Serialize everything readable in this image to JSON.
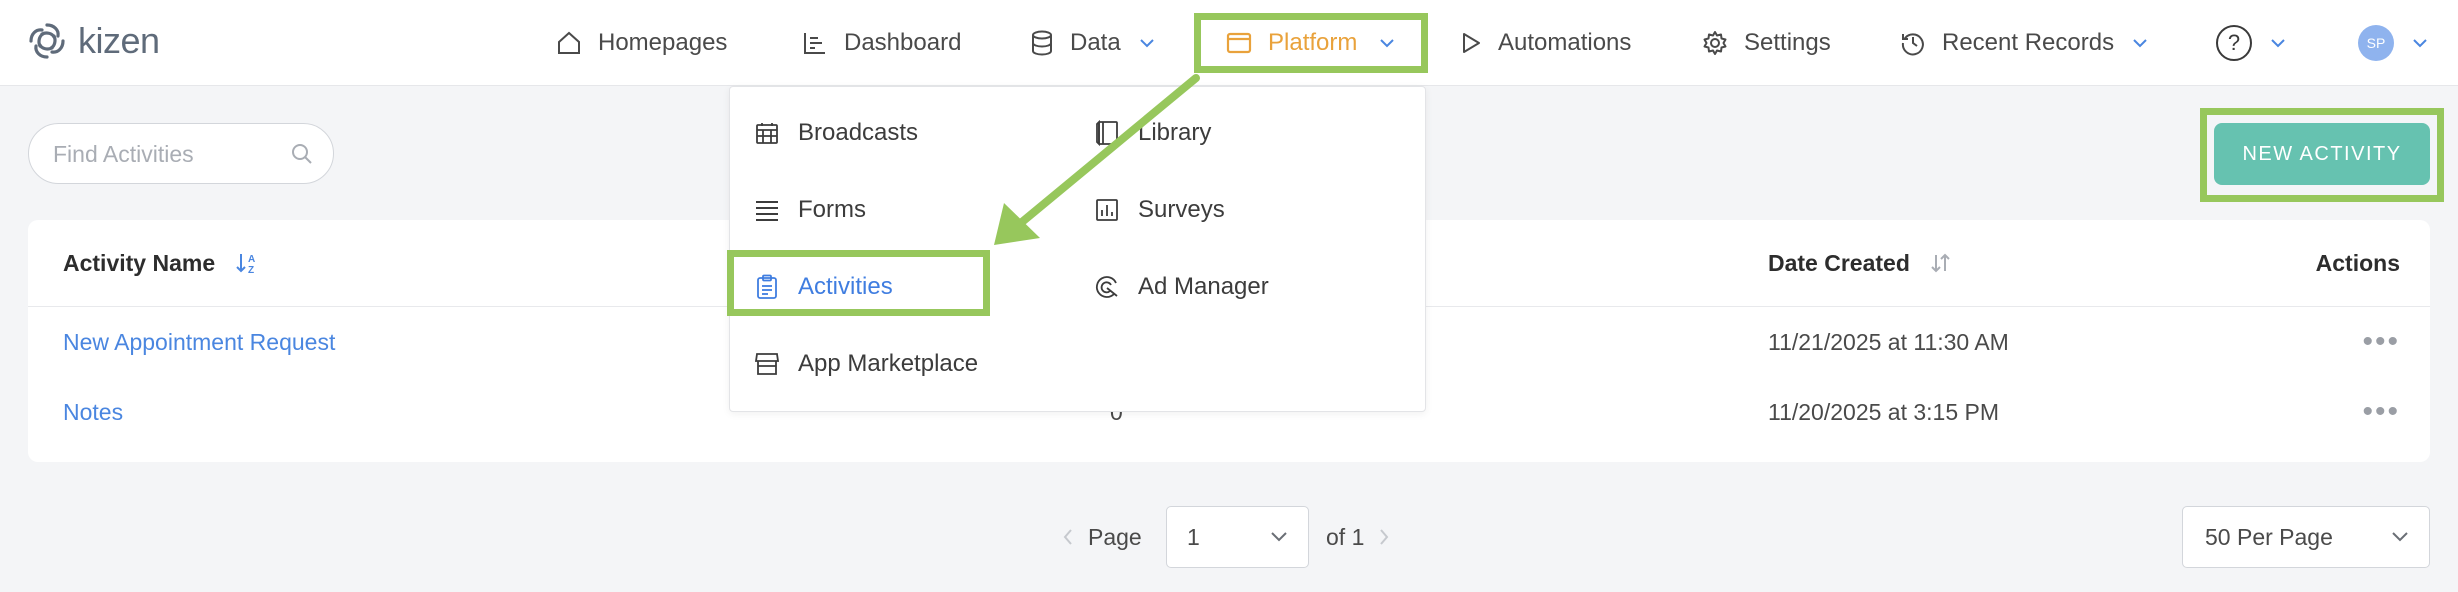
{
  "app": {
    "logo_text": "kizen"
  },
  "nav": {
    "homepages": "Homepages",
    "dashboard": "Dashboard",
    "data": "Data",
    "platform": "Platform",
    "automations": "Automations",
    "settings": "Settings",
    "recent_records": "Recent Records",
    "help_symbol": "?",
    "avatar_initials": "SP"
  },
  "platform_menu": {
    "left": [
      "Broadcasts",
      "Forms",
      "Activities",
      "App Marketplace"
    ],
    "right": [
      "Library",
      "Surveys",
      "Ad Manager"
    ],
    "active_item": "Activities"
  },
  "toolbar": {
    "search_placeholder": "Find Activities",
    "new_button": "NEW ACTIVITY"
  },
  "table": {
    "columns": {
      "name": "Activity Name",
      "date_created": "Date Created",
      "actions": "Actions"
    },
    "rows": [
      {
        "name": "New Appointment Request",
        "count": "",
        "date": "11/21/2025",
        "time": "at 11:30 AM",
        "actions": "•••"
      },
      {
        "name": "Notes",
        "count": "0",
        "date": "11/20/2025",
        "time": "at 3:15 PM",
        "actions": "•••"
      }
    ]
  },
  "pagination": {
    "page_label": "Page",
    "current_page": "1",
    "of_label": "of 1",
    "per_page": "50 Per Page"
  },
  "colors": {
    "accent_orange": "#e9a23b",
    "link_blue": "#4a86e0",
    "button_teal": "#66c2b0",
    "annotation_green": "#97c75c"
  }
}
